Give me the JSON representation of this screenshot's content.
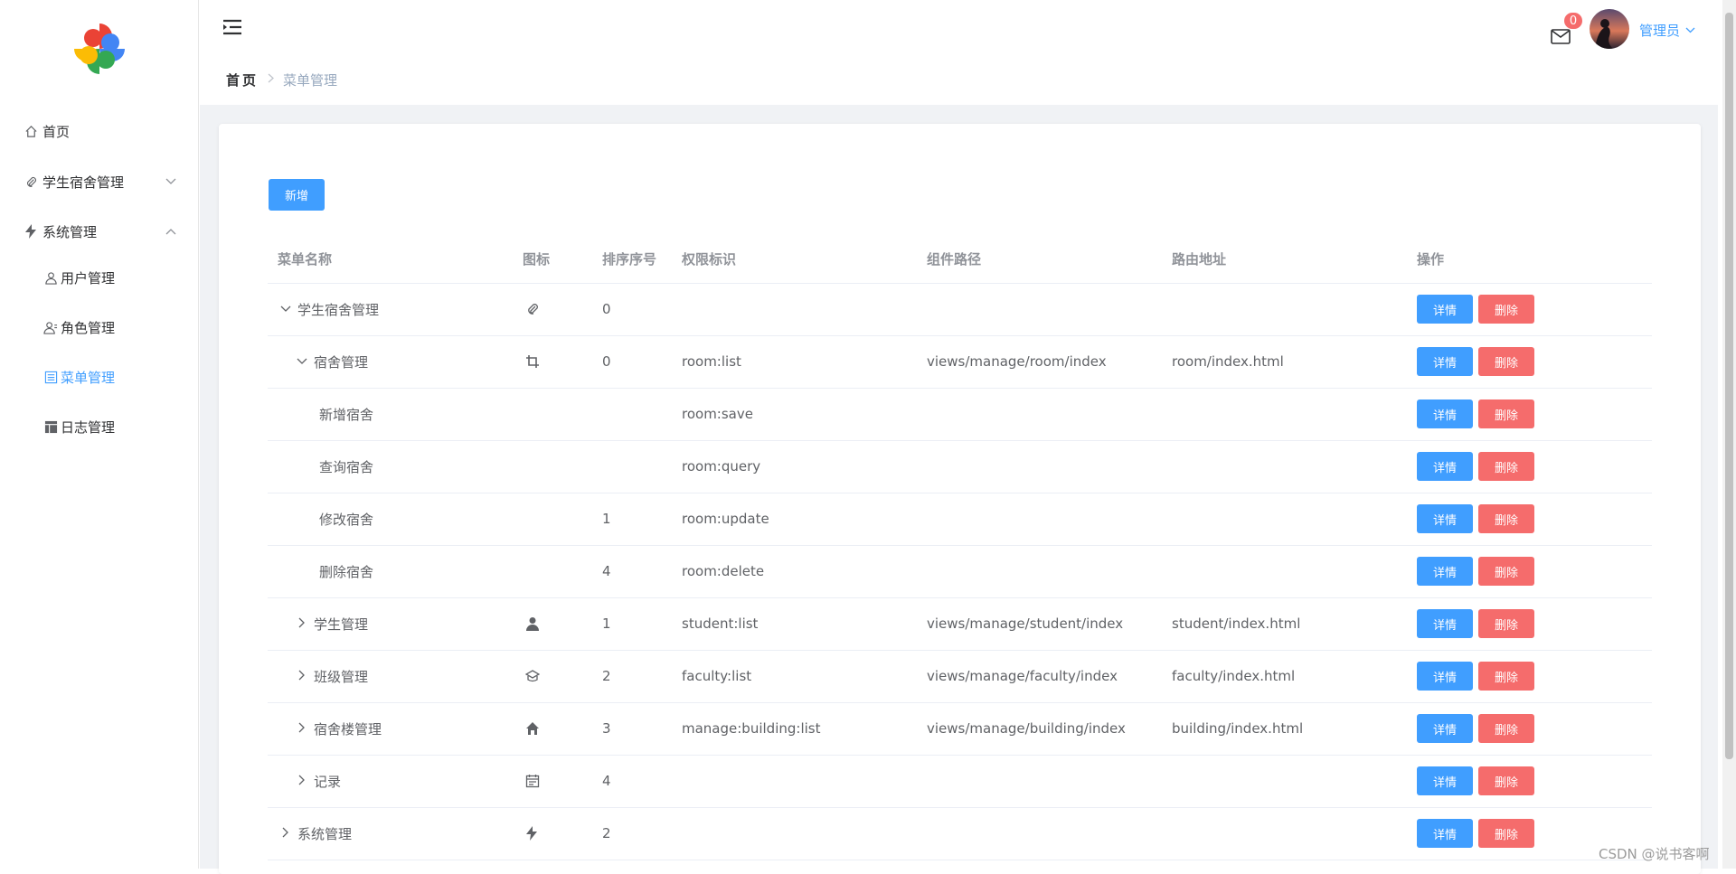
{
  "sidebar": {
    "items": [
      {
        "label": "首页",
        "icon": "home-icon"
      },
      {
        "label": "学生宿舍管理",
        "icon": "paperclip-icon"
      },
      {
        "label": "系统管理",
        "icon": "lightning-icon"
      }
    ],
    "sub_items": [
      {
        "label": "用户管理",
        "icon": "user-icon"
      },
      {
        "label": "角色管理",
        "icon": "role-icon"
      },
      {
        "label": "菜单管理",
        "icon": "menu-list-icon",
        "active": true
      },
      {
        "label": "日志管理",
        "icon": "log-icon"
      }
    ]
  },
  "header": {
    "breadcrumb": {
      "home": "首页",
      "current": "菜单管理"
    },
    "notification_count": "0",
    "user_name": "管理员"
  },
  "toolbar": {
    "add_label": "新增"
  },
  "table": {
    "columns": [
      "菜单名称",
      "图标",
      "排序序号",
      "权限标识",
      "组件路径",
      "路由地址",
      "操作"
    ],
    "rows": [
      {
        "name": "学生宿舍管理",
        "level": 0,
        "caret": "down",
        "icon": "paperclip-icon",
        "order": "0",
        "perm": "",
        "component": "",
        "route": ""
      },
      {
        "name": "宿舍管理",
        "level": 1,
        "caret": "down",
        "icon": "crop-icon",
        "order": "0",
        "perm": "room:list",
        "component": "views/manage/room/index",
        "route": "room/index.html"
      },
      {
        "name": "新增宿舍",
        "level": 2,
        "caret": "",
        "icon": "",
        "order": "",
        "perm": "room:save",
        "component": "",
        "route": ""
      },
      {
        "name": "查询宿舍",
        "level": 2,
        "caret": "",
        "icon": "",
        "order": "",
        "perm": "room:query",
        "component": "",
        "route": ""
      },
      {
        "name": "修改宿舍",
        "level": 2,
        "caret": "",
        "icon": "",
        "order": "1",
        "perm": "room:update",
        "component": "",
        "route": ""
      },
      {
        "name": "删除宿舍",
        "level": 2,
        "caret": "",
        "icon": "",
        "order": "4",
        "perm": "room:delete",
        "component": "",
        "route": ""
      },
      {
        "name": "学生管理",
        "level": 1,
        "caret": "right",
        "icon": "user-solid-icon",
        "order": "1",
        "perm": "student:list",
        "component": "views/manage/student/index",
        "route": "student/index.html"
      },
      {
        "name": "班级管理",
        "level": 1,
        "caret": "right",
        "icon": "graduation-cap-icon",
        "order": "2",
        "perm": "faculty:list",
        "component": "views/manage/faculty/index",
        "route": "faculty/index.html"
      },
      {
        "name": "宿舍楼管理",
        "level": 1,
        "caret": "right",
        "icon": "house-icon",
        "order": "3",
        "perm": "manage:building:list",
        "component": "views/manage/building/index",
        "route": "building/index.html"
      },
      {
        "name": "记录",
        "level": 1,
        "caret": "right",
        "icon": "calendar-icon",
        "order": "4",
        "perm": "",
        "component": "",
        "route": ""
      },
      {
        "name": "系统管理",
        "level": 0,
        "caret": "right",
        "icon": "lightning-icon",
        "order": "2",
        "perm": "",
        "component": "",
        "route": ""
      }
    ],
    "detail_label": "详情",
    "delete_label": "删除"
  },
  "watermark": "CSDN @说书客啊",
  "colors": {
    "primary": "#409eff",
    "danger": "#f56c6c",
    "bg": "#f0f2f5"
  }
}
